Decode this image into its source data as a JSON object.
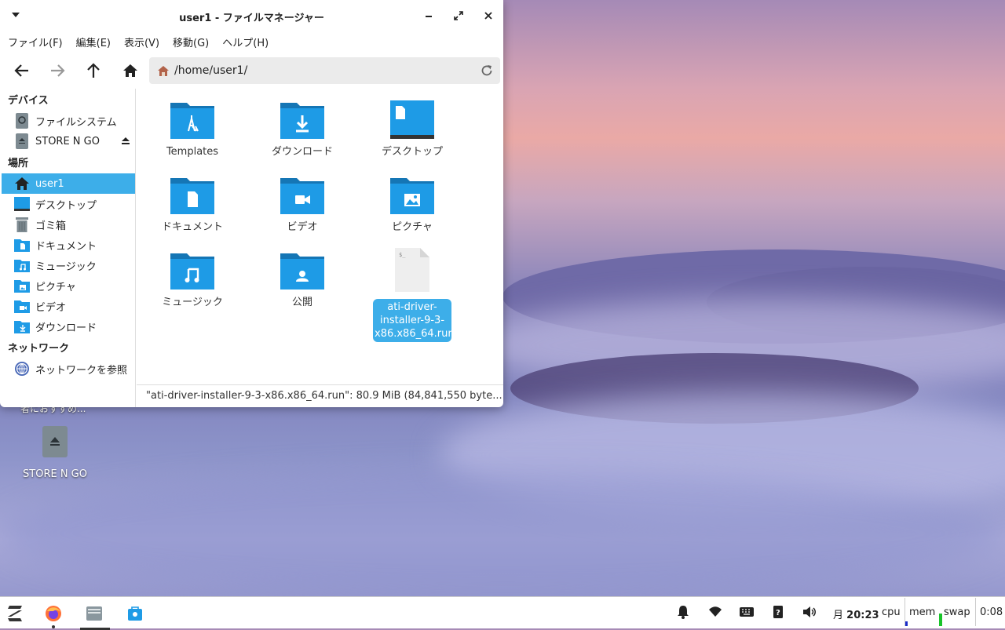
{
  "window": {
    "title": "user1 - ファイルマネージャー",
    "menu": [
      "ファイル(F)",
      "編集(E)",
      "表示(V)",
      "移動(G)",
      "ヘルプ(H)"
    ],
    "path": "/home/user1/"
  },
  "sidebar": {
    "devices_title": "デバイス",
    "devices": [
      "ファイルシステム",
      "STORE N GO"
    ],
    "places_title": "場所",
    "places": [
      "user1",
      "デスクトップ",
      "ゴミ箱",
      "ドキュメント",
      "ミュージック",
      "ピクチャ",
      "ビデオ",
      "ダウンロード"
    ],
    "network_title": "ネットワーク",
    "network": [
      "ネットワークを参照"
    ]
  },
  "files": [
    {
      "name": "Templates",
      "icon": "folder-templates-icon"
    },
    {
      "name": "ダウンロード",
      "icon": "folder-download-icon"
    },
    {
      "name": "デスクトップ",
      "icon": "folder-desktop-icon"
    },
    {
      "name": "ドキュメント",
      "icon": "folder-documents-icon"
    },
    {
      "name": "ビデオ",
      "icon": "folder-videos-icon"
    },
    {
      "name": "ピクチャ",
      "icon": "folder-pictures-icon"
    },
    {
      "name": "ミュージック",
      "icon": "folder-music-icon"
    },
    {
      "name": "公開",
      "icon": "folder-public-icon"
    },
    {
      "name": "ati-driver-installer-9-3-x86.x86_64.run",
      "name_lines": [
        "ati-driver-",
        "installer-9-3-",
        "x86.x86_64.run"
      ],
      "icon": "script-file-icon",
      "selected": true
    }
  ],
  "status": "\"ati-driver-installer-9-3-x86.x86_64.run\": 80.9 MiB (84,841,550 byte...",
  "desktop": {
    "cutoff_label": "者におすすめ...",
    "drive_label": "STORE N GO"
  },
  "taskbar": {
    "clock_day": "月",
    "clock_time": "20:23",
    "cpu_label": "cpu",
    "mem_label": "mem",
    "swap_label": "swap",
    "uptime": "0:08"
  },
  "colors": {
    "accent": "#3daee9",
    "folder": "#1e9be6",
    "folder_dark": "#1576b5"
  }
}
